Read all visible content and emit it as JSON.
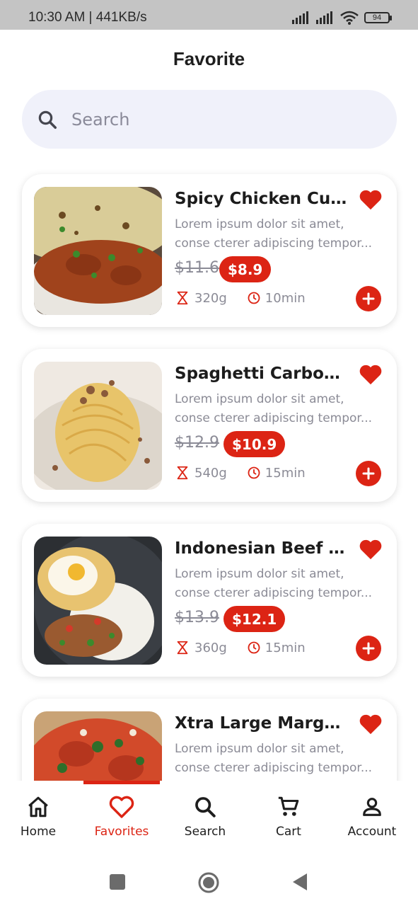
{
  "status": {
    "time": "10:30 AM | 441KB/s",
    "battery": "94"
  },
  "header": {
    "title": "Favorite"
  },
  "search": {
    "placeholder": "Search",
    "icon": "search-icon"
  },
  "colors": {
    "accent": "#dc2414",
    "text": "#1c1c1c",
    "muted": "#8b8b96",
    "search_bg": "#f0f1fa"
  },
  "items": [
    {
      "title": "Spicy Chicken Cur...",
      "desc1": "Lorem ipsum dolor sit amet,",
      "desc2": "conse cterer adipiscing tempor...",
      "old_price": "$11.6",
      "price": "$8.9",
      "weight": "320g",
      "time": "10min",
      "favorited": true
    },
    {
      "title": "Spaghetti Carbon...",
      "desc1": "Lorem ipsum dolor sit amet,",
      "desc2": "conse cterer adipiscing tempor...",
      "old_price": "$12.9",
      "price": "$10.9",
      "weight": "540g",
      "time": "15min",
      "favorited": true
    },
    {
      "title": "Indonesian Beef St...",
      "desc1": "Lorem ipsum dolor sit amet,",
      "desc2": "conse cterer adipiscing tempor...",
      "old_price": "$13.9",
      "price": "$12.1",
      "weight": "360g",
      "time": "15min",
      "favorited": true
    },
    {
      "title": "Xtra Large Marghe...",
      "desc1": "Lorem ipsum dolor sit amet,",
      "desc2": "conse cterer adipiscing tempor...",
      "old_price": "",
      "price": "",
      "weight": "",
      "time": "",
      "favorited": true
    }
  ],
  "nav": [
    {
      "label": "Home",
      "icon": "home-icon",
      "active": false
    },
    {
      "label": "Favorites",
      "icon": "heart-icon",
      "active": true
    },
    {
      "label": "Search",
      "icon": "search-icon",
      "active": false
    },
    {
      "label": "Cart",
      "icon": "cart-icon",
      "active": false
    },
    {
      "label": "Account",
      "icon": "account-icon",
      "active": false
    }
  ]
}
